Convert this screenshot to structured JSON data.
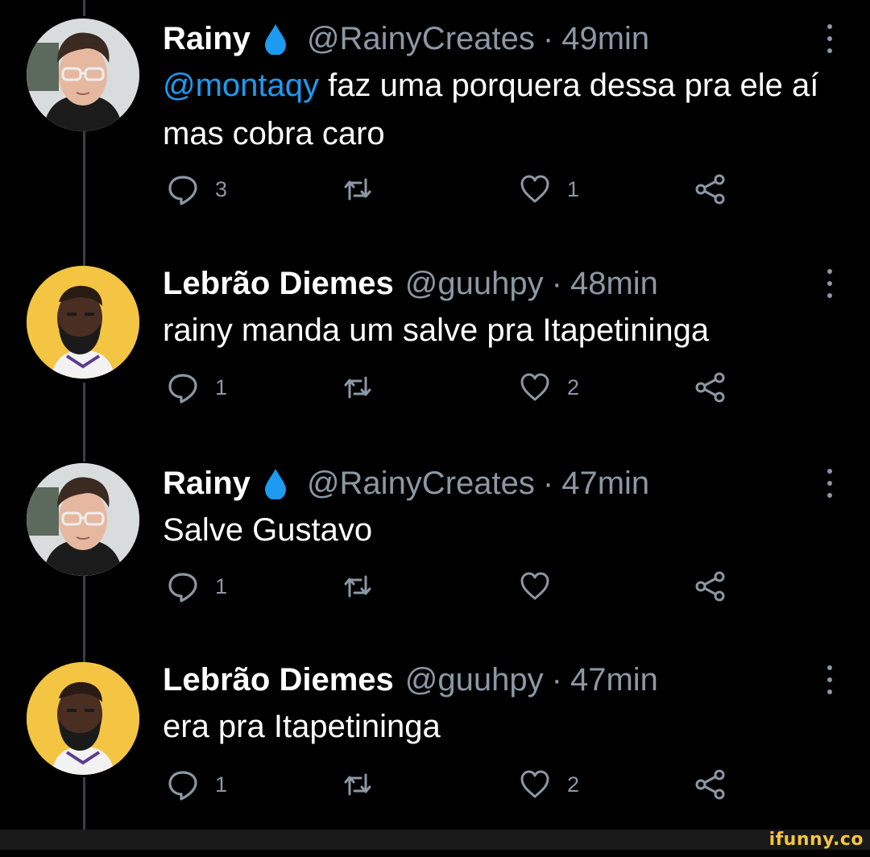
{
  "tweets": [
    {
      "name": "Rainy",
      "verified_icon": "water-drop-icon",
      "handle": "@RainyCreates",
      "separator": "·",
      "time": "49min",
      "mention": "@montaqy",
      "text": " faz uma porquera dessa pra ele aí mas cobra caro",
      "reply_count": "3",
      "retweet_count": "",
      "like_count": "1"
    },
    {
      "name": "Lebrão Diemes",
      "handle": "@guuhpy",
      "separator": "·",
      "time": "48min",
      "text": "rainy manda um salve pra Itapetininga",
      "reply_count": "1",
      "retweet_count": "",
      "like_count": "2"
    },
    {
      "name": "Rainy",
      "verified_icon": "water-drop-icon",
      "handle": "@RainyCreates",
      "separator": "·",
      "time": "47min",
      "text": "Salve Gustavo",
      "reply_count": "1",
      "retweet_count": "",
      "like_count": ""
    },
    {
      "name": "Lebrão Diemes",
      "handle": "@guuhpy",
      "separator": "·",
      "time": "47min",
      "text": "era pra Itapetininga",
      "reply_count": "1",
      "retweet_count": "",
      "like_count": "2"
    }
  ],
  "watermark": "ifunny.co",
  "colors": {
    "background": "#000000",
    "text": "#ffffff",
    "secondary": "#8b98a5",
    "mention": "#1d9bf0",
    "thread_line": "#3a3f44",
    "drop": "#1d9bf0",
    "watermark": "#f4c542"
  },
  "icons": [
    "reply-icon",
    "retweet-icon",
    "like-icon",
    "share-icon",
    "more-icon",
    "water-drop-icon"
  ]
}
